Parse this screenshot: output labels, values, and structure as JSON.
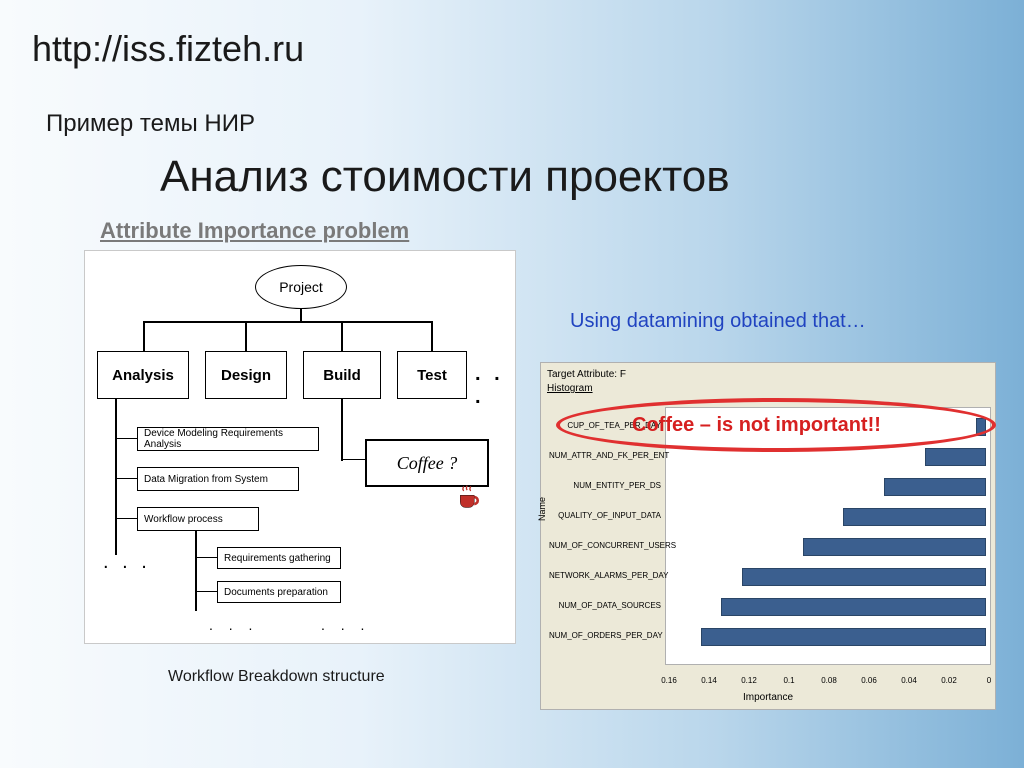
{
  "url": "http://iss.fizteh.ru",
  "subtitle": "Пример темы НИР",
  "title": "Анализ стоимости проектов",
  "attribute_heading": "Attribute Importance problem",
  "datamining_note": "Using datamining obtained that…",
  "coffee_note": "Coffee – is not important",
  "coffee_bang": "!!",
  "wbs_caption": "Workflow Breakdown structure",
  "diagram": {
    "root": "Project",
    "phases": {
      "analysis": "Analysis",
      "design": "Design",
      "build": "Build",
      "test": "Test"
    },
    "dots": ". . .",
    "analysis_tasks": {
      "t1": "Device Modeling Requirements Analysis",
      "t2": "Data Migration from System",
      "t3": "Workflow process",
      "t4": "Requirements gathering",
      "t5": "Documents preparation"
    },
    "coffee_label": "Coffee ?",
    "ellipsis_a": ". . .",
    "ellipsis_b": ". . .",
    "ellipsis_c": ". . ."
  },
  "chart": {
    "target_label": "Target Attribute: F",
    "hist_label": "Histogram",
    "yaxis": "Name",
    "xaxis": "Importance"
  },
  "chart_data": {
    "type": "bar",
    "orientation": "horizontal",
    "xlabel": "Importance",
    "ylabel": "Name",
    "x_ticks": [
      0.16,
      0.14,
      0.12,
      0.1,
      0.08,
      0.06,
      0.04,
      0.02,
      0.0
    ],
    "x_reversed": true,
    "categories": [
      "CUP_OF_TEA_PER_DAY",
      "NUM_ATTR_AND_FK_PER_ENT",
      "NUM_ENTITY_PER_DS",
      "QUALITY_OF_INPUT_DATA",
      "NUM_OF_CONCURRENT_USERS",
      "NETWORK_ALARMS_PER_DAY",
      "NUM_OF_DATA_SOURCES",
      "NUM_OF_ORDERS_PER_DAY"
    ],
    "values": [
      0.005,
      0.03,
      0.05,
      0.07,
      0.09,
      0.12,
      0.13,
      0.14
    ]
  }
}
